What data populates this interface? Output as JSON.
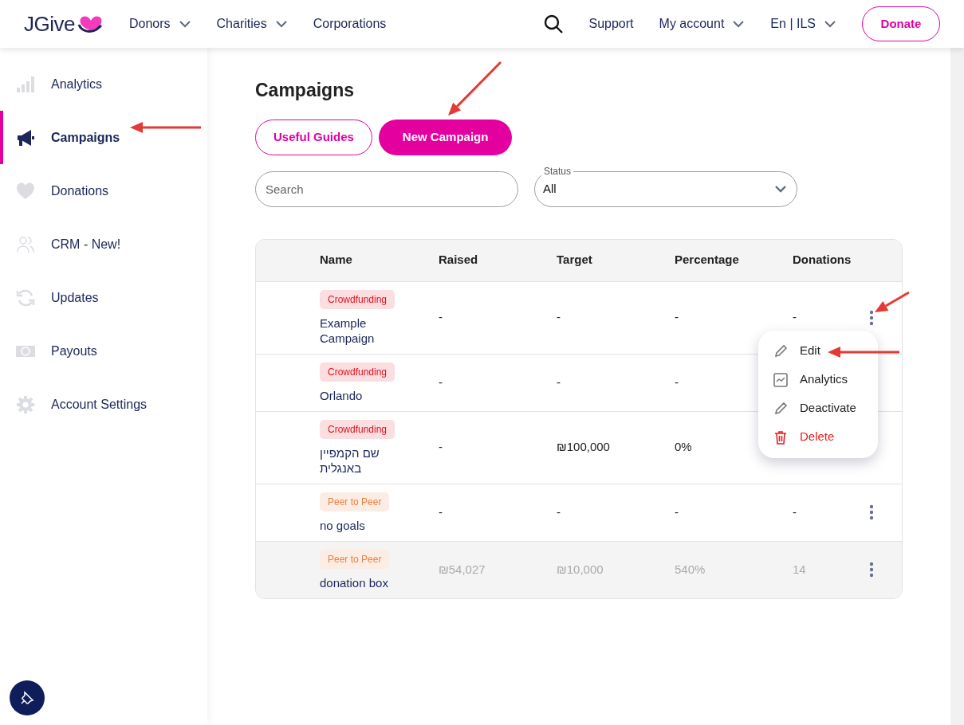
{
  "navbar": {
    "logo": "JGive",
    "left_items": [
      {
        "label": "Donors",
        "dropdown": true
      },
      {
        "label": "Charities",
        "dropdown": true
      },
      {
        "label": "Corporations",
        "dropdown": false
      }
    ],
    "right_items": [
      {
        "label": "Support",
        "dropdown": false
      },
      {
        "label": "My account",
        "dropdown": true
      },
      {
        "label": "En | ILS",
        "dropdown": true
      }
    ],
    "donate_button": "Donate"
  },
  "sidebar": {
    "items": [
      {
        "label": "Analytics",
        "selected": false
      },
      {
        "label": "Campaigns",
        "selected": true
      },
      {
        "label": "Donations",
        "selected": false
      },
      {
        "label": "CRM - New!",
        "selected": false
      },
      {
        "label": "Updates",
        "selected": false
      },
      {
        "label": "Payouts",
        "selected": false
      },
      {
        "label": "Account Settings",
        "selected": false
      }
    ]
  },
  "page": {
    "title": "Campaigns",
    "buttons": [
      {
        "label": "Useful Guides",
        "kind": "outline"
      },
      {
        "label": "New Campaign",
        "kind": "filled"
      }
    ],
    "search": {
      "placeholder": "Search"
    },
    "status_filter": {
      "label": "Status",
      "value": "All"
    }
  },
  "table": {
    "columns": [
      "Name",
      "Raised",
      "Target",
      "Percentage",
      "Donations"
    ],
    "rows": [
      {
        "type": "Crowdfunding",
        "color": "#e0101e",
        "name": "Example Campaign",
        "raised": "-",
        "target": "-",
        "percentage": "-",
        "donations": "-",
        "active": true,
        "menu_open": true
      },
      {
        "type": "Crowdfunding",
        "color": "#e0101e",
        "name": "Orlando",
        "raised": "-",
        "target": "-",
        "percentage": "-",
        "active": true,
        "menu_open": false
      },
      {
        "type": "Crowdfunding",
        "color": "#e0101e",
        "name": "שם הקמפיין באנגלית",
        "raised": "-",
        "target": "₪100,000",
        "percentage": "0%",
        "active": true,
        "menu_open": false
      },
      {
        "type": "Peer to Peer",
        "color": "#e8803f",
        "name": "no goals",
        "raised": "-",
        "target": "-",
        "percentage": "-",
        "donations": "-",
        "active": true,
        "menu_open": false
      },
      {
        "type": "Peer to Peer",
        "color": "#e8803f",
        "name": "donation box",
        "raised": "₪54,027",
        "target": "₪10,000",
        "percentage": "540%",
        "donations": "14",
        "active": false,
        "menu_open": false
      }
    ]
  },
  "row_menu": {
    "items": [
      {
        "label": "Edit",
        "kind": "edit"
      },
      {
        "label": "Analytics",
        "kind": "analytics"
      },
      {
        "label": "Deactivate",
        "kind": "deactivate"
      },
      {
        "label": "Delete",
        "kind": "delete"
      }
    ]
  }
}
